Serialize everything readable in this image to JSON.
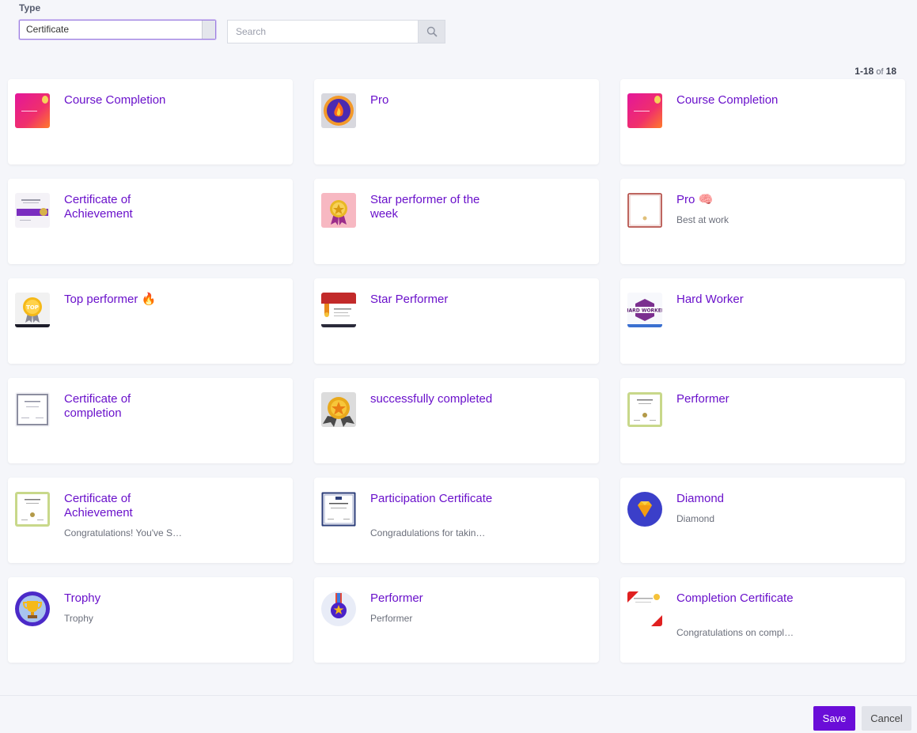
{
  "filter": {
    "type_label": "Type",
    "type_value": "Certificate",
    "search_placeholder": "Search"
  },
  "pagination": {
    "range": "1-18",
    "of": "of",
    "total": "18"
  },
  "cards": [
    {
      "title": "Course Completion",
      "desc": "",
      "icon": "pink-gradient-certificate"
    },
    {
      "title": "Pro",
      "desc": "",
      "icon": "flame-badge"
    },
    {
      "title": "Course Completion",
      "desc": "",
      "icon": "pink-gradient-certificate"
    },
    {
      "title": "Certificate of Achievement",
      "desc": "",
      "icon": "purple-ribbon-certificate"
    },
    {
      "title": "Star performer of the week",
      "desc": "",
      "icon": "star-medal"
    },
    {
      "title": "Pro 🧠",
      "desc": "Best at work",
      "icon": "red-border-certificate"
    },
    {
      "title": "Top performer 🔥",
      "desc": "",
      "icon": "top-badge"
    },
    {
      "title": "Star Performer",
      "desc": "",
      "icon": "red-header-certificate"
    },
    {
      "title": "Hard Worker",
      "desc": "",
      "icon": "hard-worker-badge"
    },
    {
      "title": "Certificate of completion",
      "desc": "",
      "icon": "gray-border-certificate"
    },
    {
      "title": "successfully completed",
      "desc": "",
      "icon": "gold-star-ribbon"
    },
    {
      "title": "Performer",
      "desc": "",
      "icon": "green-border-certificate"
    },
    {
      "title": "Certificate of Achievement",
      "desc": "Congratulations! You've S…",
      "icon": "green-border-certificate"
    },
    {
      "title": "Participation Certificate",
      "desc": "Congradulations for takin…",
      "icon": "blue-border-certificate"
    },
    {
      "title": "Diamond",
      "desc": "Diamond",
      "icon": "diamond-badge"
    },
    {
      "title": "Trophy",
      "desc": "Trophy",
      "icon": "trophy-badge"
    },
    {
      "title": "Performer",
      "desc": "Performer",
      "icon": "medal-badge"
    },
    {
      "title": "Completion Certificate",
      "desc": "Congratulations on compl…",
      "icon": "red-corner-certificate"
    }
  ],
  "footer": {
    "save_label": "Save",
    "cancel_label": "Cancel"
  },
  "colors": {
    "accent": "#6a11cb",
    "save_button": "#6a0dd8"
  }
}
